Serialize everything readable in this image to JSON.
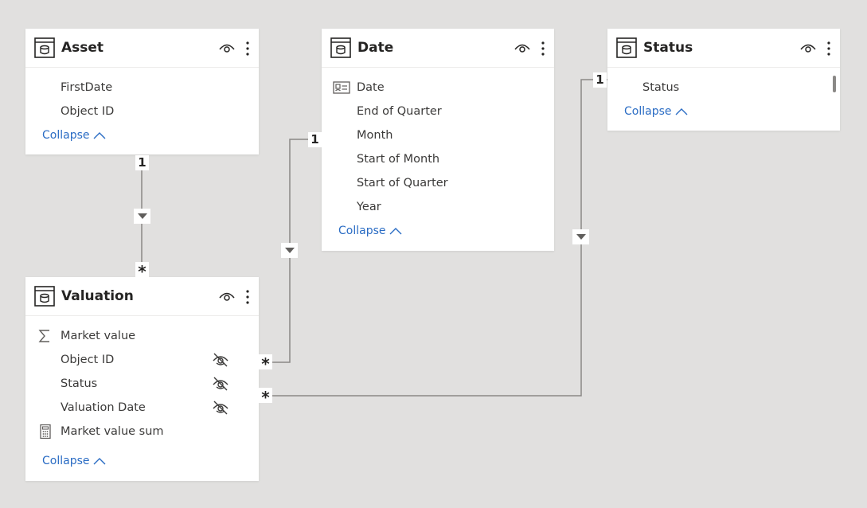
{
  "tables": {
    "asset": {
      "title": "Asset",
      "fields": [
        "FirstDate",
        "Object ID"
      ],
      "collapse_label": "Collapse"
    },
    "date": {
      "title": "Date",
      "fields": [
        "Date",
        "End of Quarter",
        "Month",
        "Start of Month",
        "Start of Quarter",
        "Year"
      ],
      "collapse_label": "Collapse"
    },
    "status": {
      "title": "Status",
      "fields": [
        "Status"
      ],
      "collapse_label": "Collapse"
    },
    "valuation": {
      "title": "Valuation",
      "fields": [
        "Market value",
        "Object ID",
        "Status",
        "Valuation Date",
        "Market value sum"
      ],
      "collapse_label": "Collapse"
    }
  },
  "relationships": {
    "asset_valuation": {
      "one_label": "1",
      "many_label": "*"
    },
    "date_valuation": {
      "one_label": "1",
      "many_label": "*"
    },
    "status_valuation": {
      "one_label": "1",
      "many_label": "*"
    }
  },
  "icons": {
    "table": "table-icon",
    "visibility": "eye-icon",
    "more": "more-options-icon",
    "date_field": "date-field-icon",
    "sum": "sigma-icon",
    "measure": "calculator-icon",
    "hidden": "hidden-eye-icon",
    "collapse": "chevron-up-icon",
    "filter_direction": "triangle-down-icon"
  },
  "colors": {
    "canvas": "#e1e0df",
    "card": "#ffffff",
    "link": "#2a6cc4",
    "wire": "#8a8886"
  }
}
